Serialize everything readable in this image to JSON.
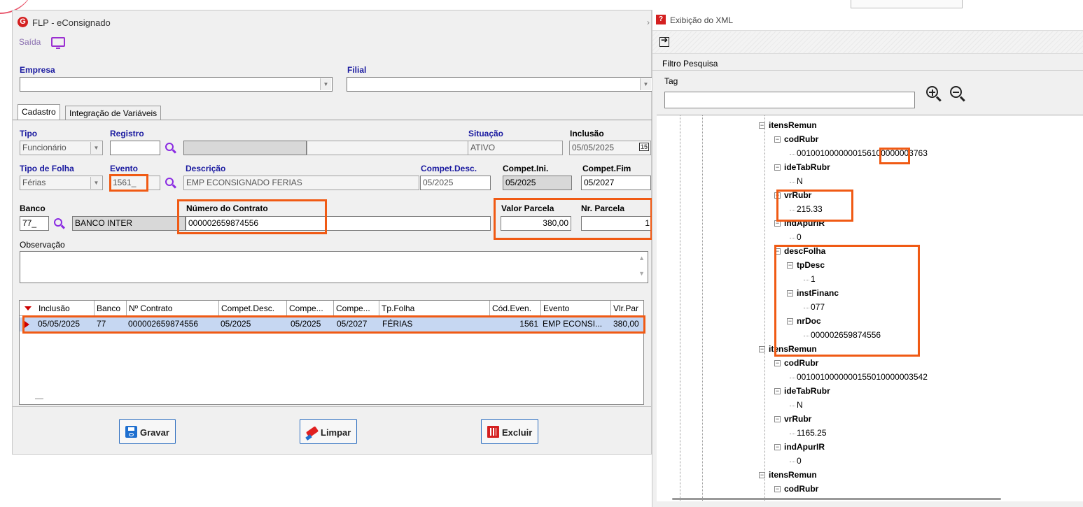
{
  "left_window": {
    "title": "FLP - eConsignado",
    "saida_label": "Saída",
    "empresa_label": "Empresa",
    "filial_label": "Filial",
    "tabs": [
      "Cadastro",
      "Integração de Variáveis"
    ],
    "form": {
      "tipo_label": "Tipo",
      "tipo_value": "Funcionário",
      "registro_label": "Registro",
      "situacao_label": "Situação",
      "situacao_value": "ATIVO",
      "inclusao_label": "Inclusão",
      "inclusao_value": "05/05/2025",
      "calendar_day": "15",
      "tipo_folha_label": "Tipo de Folha",
      "tipo_folha_value": "Férias",
      "evento_label": "Evento",
      "evento_value": "1561_",
      "descricao_label": "Descrição",
      "descricao_value": "EMP ECONSIGNADO FERIAS",
      "compet_desc_label": "Compet.Desc.",
      "compet_desc_value": "05/2025",
      "compet_ini_label": "Compet.Ini.",
      "compet_ini_value": "05/2025",
      "compet_fim_label": "Compet.Fim",
      "compet_fim_value": "05/2027",
      "banco_label": "Banco",
      "banco_code": "77_",
      "banco_name": "BANCO INTER",
      "contrato_label": "Número do Contrato",
      "contrato_value": "000002659874556",
      "valor_parcela_label": "Valor Parcela",
      "valor_parcela_value": "380,00",
      "nr_parcela_label": "Nr. Parcela",
      "nr_parcela_value": "1",
      "observacao_label": "Observação"
    },
    "grid": {
      "columns": [
        "Inclusão",
        "Banco",
        "Nº Contrato",
        "Compet.Desc.",
        "Compe...",
        "Compe...",
        "Tp.Folha",
        "Cód.Even.",
        "Evento",
        "Vlr.Par"
      ],
      "row": [
        "05/05/2025",
        "77",
        "000002659874556",
        "05/2025",
        "05/2025",
        "05/2027",
        "FÉRIAS",
        "1561",
        "EMP ECONSI...",
        "380,00"
      ],
      "footer_mark": "—"
    },
    "buttons": {
      "gravar": "Gravar",
      "limpar": "Limpar",
      "excluir": "Excluir"
    }
  },
  "right_window": {
    "title": "Exibição do XML",
    "filtro_label": "Filtro Pesquisa",
    "tag_label": "Tag",
    "tree": [
      {
        "t": "itensRemun",
        "b": true
      },
      {
        "t": "codRubr",
        "b": true
      },
      {
        "t": "0010010000000156100000003763",
        "b": false
      },
      {
        "t": "ideTabRubr",
        "b": true
      },
      {
        "t": "N",
        "b": false
      },
      {
        "t": "vrRubr",
        "b": true
      },
      {
        "t": "215.33",
        "b": false
      },
      {
        "t": "indApurIR",
        "b": true
      },
      {
        "t": "0",
        "b": false
      },
      {
        "t": "descFolha",
        "b": true
      },
      {
        "t": "tpDesc",
        "b": true
      },
      {
        "t": "1",
        "b": false
      },
      {
        "t": "instFinanc",
        "b": true
      },
      {
        "t": "077",
        "b": false
      },
      {
        "t": "nrDoc",
        "b": true
      },
      {
        "t": "000002659874556",
        "b": false
      },
      {
        "t": "itensRemun",
        "b": true
      },
      {
        "t": "codRubr",
        "b": true
      },
      {
        "t": "0010010000000155010000003542",
        "b": false
      },
      {
        "t": "ideTabRubr",
        "b": true
      },
      {
        "t": "N",
        "b": false
      },
      {
        "t": "vrRubr",
        "b": true
      },
      {
        "t": "1165.25",
        "b": false
      },
      {
        "t": "indApurIR",
        "b": true
      },
      {
        "t": "0",
        "b": false
      },
      {
        "t": "itensRemun",
        "b": true
      },
      {
        "t": "codRubr",
        "b": true
      }
    ]
  },
  "colors": {
    "highlight": "#f05a14",
    "label_blue": "#1a1aa0",
    "search_purple": "#8a2be2",
    "selected_row": "#c6d7f2"
  }
}
